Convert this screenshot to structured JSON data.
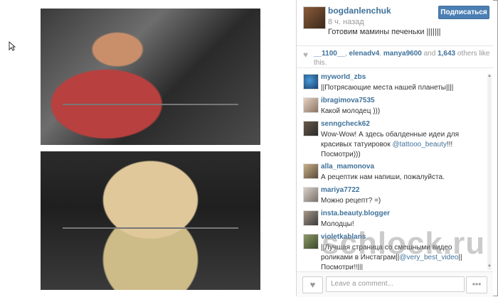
{
  "post": {
    "username": "bogdanlenchuk",
    "time": "8 ч. назад",
    "caption": "Готовим мамины печеньки |||||||",
    "follow_label": "Подписаться"
  },
  "likes": {
    "users": [
      "__1100__",
      "elenadv4",
      "manya9600"
    ],
    "and_text": "and",
    "count_text": "1,643",
    "others_text": "others like this."
  },
  "comments": [
    {
      "user": "myworld_zbs",
      "text": "||Потрясающие места нашей планеты||||"
    },
    {
      "user": "ibragimova7535",
      "text": "Какой молодец )))"
    },
    {
      "user": "senngcheck62",
      "text": "Wow-Wow! А здесь обалденные идеи для красивых татуировок",
      "tag": "@tattooo_beauty",
      "after": "!!! Посмотри)))"
    },
    {
      "user": "alla_mamonova",
      "text": "А рецептик нам напиши, пожалуйста."
    },
    {
      "user": "mariya7722",
      "text": "Можно рецепт? =)"
    },
    {
      "user": "insta.beauty.blogger",
      "text": "Молодцы!"
    },
    {
      "user": "violetkablans",
      "text": "||Лучшая страница со смешными видео роликами в Инстаграм||",
      "tag": "@very_best_video",
      "after": "||Посмотри!!|||"
    }
  ],
  "bottom": {
    "comment_placeholder": "Leave a comment...",
    "like_icon": "♥",
    "more_icon": "•••"
  },
  "watermark": "schlock.ru",
  "colors": {
    "link": "#3f729b",
    "follow_button": "#4b7fb4"
  }
}
